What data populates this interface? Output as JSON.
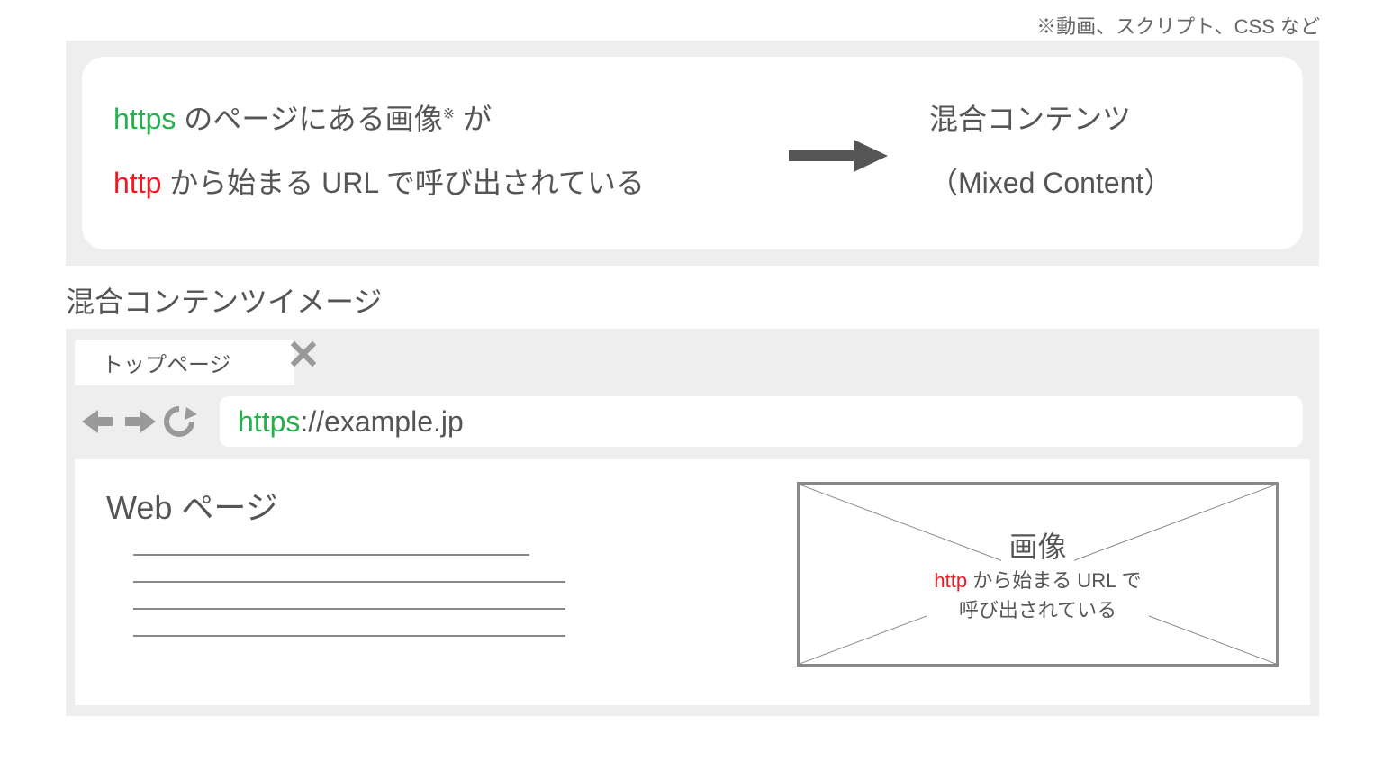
{
  "footnote_top": "※動画、スクリプト、CSS など",
  "card": {
    "line1_https": "https",
    "line1_rest_a": " のページにある画像",
    "annot_mark": "※",
    "line1_rest_b": " が",
    "line2_http": "http",
    "line2_rest": " から始まる URL で呼び出されている",
    "right_line1": "混合コンテンツ",
    "right_line2": "（Mixed Content）"
  },
  "section_title": "混合コンテンツイメージ",
  "browser": {
    "tab_label": "トップページ",
    "url_scheme": "https",
    "url_rest": "://example.jp"
  },
  "viewport": {
    "heading": "Web ページ",
    "image_label": "画像",
    "image_sub_http": "http",
    "image_sub_rest1": " から始まる URL で",
    "image_sub_line2": "呼び出されている"
  }
}
